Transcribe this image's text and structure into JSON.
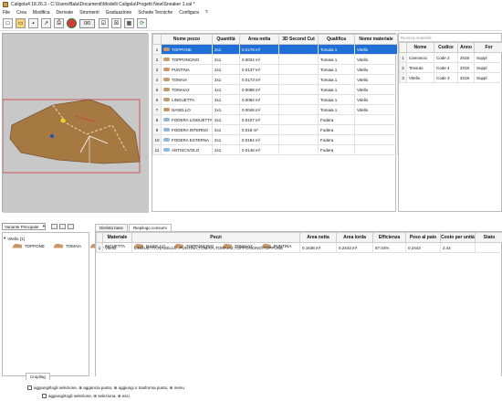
{
  "window": {
    "title": "Caligola4 18.26.3 - C:\\Users\\Bala\\Documenti\\Modelli Caligola\\Progetti New\\Sneaker 1.cal *"
  },
  "menu": [
    "File",
    "Crea",
    "Modifica",
    "Derivate",
    "Strumenti",
    "Graduazione",
    "Schede Tecniche",
    "Configura",
    "?"
  ],
  "toolbar": {
    "counter": "0/0"
  },
  "pieces_table": {
    "headers": [
      "Nome pezzo",
      "Quantità",
      "Area netta",
      "3D Second Cut",
      "Qualifica",
      "Nome materiale"
    ],
    "rows": [
      {
        "n": "1",
        "name": "TOPPONE",
        "qty": "2x1",
        "area": "0.0178 m²",
        "cut": "",
        "qual": "Tomaia 1",
        "mat": "Vitello",
        "icon": "brown"
      },
      {
        "n": "2",
        "name": "TOPPONCINO",
        "qty": "2x1",
        "area": "0.0024 m²",
        "cut": "",
        "qual": "Tomaia 1",
        "mat": "Vitello",
        "icon": "brown"
      },
      {
        "n": "3",
        "name": "PUNTINA",
        "qty": "2x1",
        "area": "0.0137 m²",
        "cut": "",
        "qual": "Tomaia 1",
        "mat": "Vitello",
        "icon": "brown"
      },
      {
        "n": "4",
        "name": "TOMAIA",
        "qty": "2x1",
        "area": "0.0173 m²",
        "cut": "",
        "qual": "Tomaia 1",
        "mat": "Vitello",
        "icon": "brown"
      },
      {
        "n": "5",
        "name": "TOMAIA2",
        "qty": "4x1",
        "area": "0.0088 m²",
        "cut": "",
        "qual": "Tomaia 1",
        "mat": "Vitello",
        "icon": "brown"
      },
      {
        "n": "6",
        "name": "LINGUETTA",
        "qty": "2x1",
        "area": "0.0084 m²",
        "cut": "",
        "qual": "Tomaia 1",
        "mat": "Vitello",
        "icon": "brown"
      },
      {
        "n": "7",
        "name": "NASELLO",
        "qty": "2x1",
        "area": "0.0048 m²",
        "cut": "",
        "qual": "Tomaia 1",
        "mat": "Vitello",
        "icon": "brown"
      },
      {
        "n": "8",
        "name": "FODERA LINGUETTA",
        "qty": "2x1",
        "area": "0.0107 m²",
        "cut": "",
        "qual": "Fodera",
        "mat": "",
        "icon": "blue"
      },
      {
        "n": "9",
        "name": "FODERA INTERNO",
        "qty": "2x1",
        "area": "0.018 m²",
        "cut": "",
        "qual": "Fodera",
        "mat": "",
        "icon": "blue"
      },
      {
        "n": "10",
        "name": "FODERA ESTERNA",
        "qty": "2x1",
        "area": "0.0154 m²",
        "cut": "",
        "qual": "Fodera",
        "mat": "",
        "icon": "blue"
      },
      {
        "n": "11",
        "name": "ANTISCIVOLO",
        "qty": "2x1",
        "area": "0.0146 m²",
        "cut": "",
        "qual": "Fodera",
        "mat": "",
        "icon": "blue"
      }
    ]
  },
  "materials": {
    "search_placeholder": "Ricerca materiali",
    "headers": [
      "Nome",
      "Codice",
      "Anno",
      "For"
    ],
    "rows": [
      {
        "n": "1",
        "name": "Camoscio",
        "code": "Code 2",
        "year": "2018",
        "sup": "Suppl"
      },
      {
        "n": "2",
        "name": "Tessuto",
        "code": "Code 4",
        "year": "2018",
        "sup": "Suppl"
      },
      {
        "n": "3",
        "name": "Vitello",
        "code": "Code 3",
        "year": "2018",
        "sup": "Suppl"
      }
    ]
  },
  "variant": {
    "label": "Variante Principale"
  },
  "tree": {
    "root": "Vitello [1]",
    "items": [
      "TOPPONE",
      "TOMAIA",
      "LINGUETTA",
      "NASELLO",
      "TOPPONCINO",
      "TOMAIA2",
      "PUNTINA"
    ]
  },
  "tabs": [
    "Distinta base",
    "Riepilogo consumi"
  ],
  "summary": {
    "headers": [
      "Materiale",
      "Pezzi",
      "Area netta",
      "Area lorda",
      "Efficienza",
      "Peso al paio",
      "Costo per unità",
      "Stato"
    ],
    "row": {
      "n": "1",
      "mat": "Vitello",
      "pezzi": "LINGUETTA,NASELLO ,PUNTINA,TOMAIA,TOMAIA2,TOPPONCINO,TOPPONE",
      "netta": "0.1638 m²",
      "lorda": "0.2443 m²",
      "eff": "67.04%",
      "peso": "0.2443",
      "costo": "2.44",
      "stato": ""
    }
  },
  "status": {
    "tab": "Cropling",
    "line1": "aggiungi/togli selezione, ⊕ aggancia punto, ⊕ aggiungi o trasforma punto, ⊕ menu",
    "line2": "aggiungi/togli selezione, ⊕ seleziona, ⊕ esci"
  }
}
